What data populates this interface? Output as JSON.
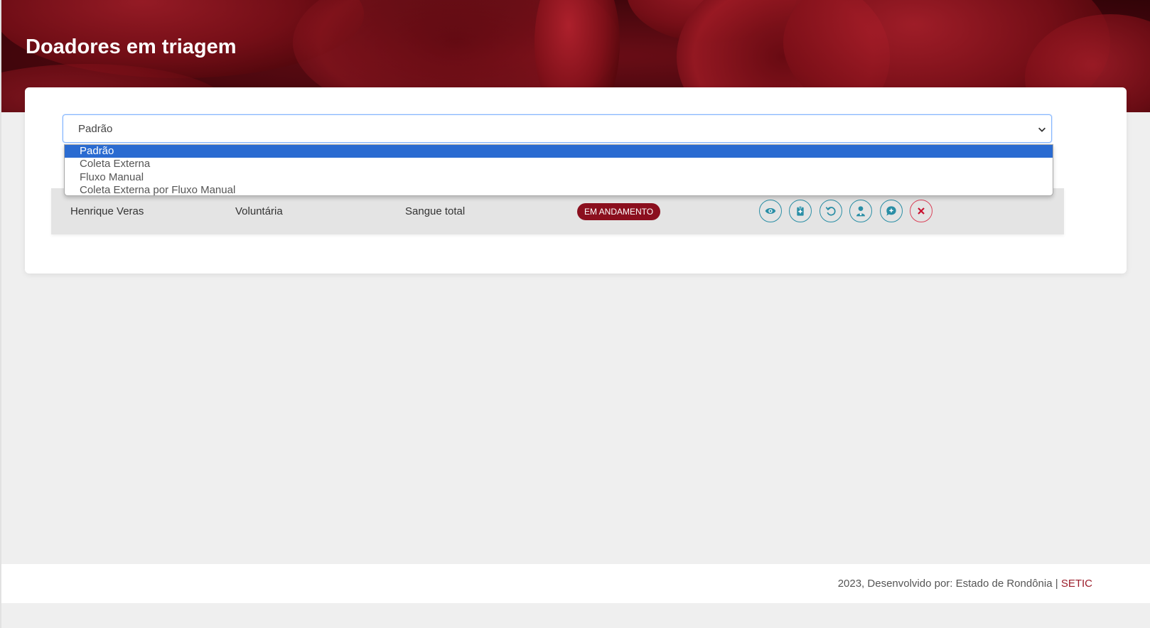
{
  "header": {
    "title": "Doadores em triagem"
  },
  "filter": {
    "selected": "Padrão",
    "options": [
      {
        "label": "Padrão",
        "selected": true
      },
      {
        "label": "Coleta Externa",
        "selected": false
      },
      {
        "label": "Fluxo Manual",
        "selected": false
      },
      {
        "label": "Coleta Externa por Fluxo Manual",
        "selected": false
      }
    ]
  },
  "rows": [
    {
      "name": "Henrique Veras",
      "type": "Voluntária",
      "donation": "Sangue total",
      "status": "EM ANDAMENTO",
      "actions": [
        {
          "icon": "eye-icon",
          "name": "view-button"
        },
        {
          "icon": "clipboard-plus-icon",
          "name": "triage-button"
        },
        {
          "icon": "undo-icon",
          "name": "revert-button"
        },
        {
          "icon": "doctor-icon",
          "name": "doctor-button"
        },
        {
          "icon": "comment-plus-icon",
          "name": "comment-button"
        },
        {
          "icon": "close-icon",
          "name": "cancel-button"
        }
      ]
    }
  ],
  "footer": {
    "text": "2023, Desenvolvido por: Estado de Rondônia |",
    "link": "SETIC"
  },
  "colors": {
    "banner": "#3e060b",
    "status_badge": "#8b0f1e",
    "action_teal": "#2a8ea5",
    "action_danger": "#d9435a",
    "select_highlight": "#2a6bd1",
    "footer_link": "#9b1c2a"
  }
}
